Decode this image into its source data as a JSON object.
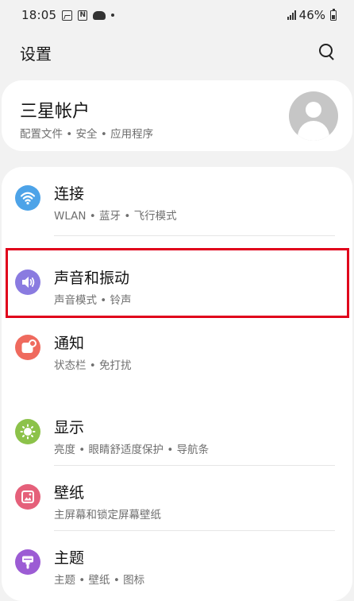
{
  "status_bar": {
    "time": "18:05",
    "battery": "46%"
  },
  "header": {
    "title": "设置"
  },
  "account": {
    "title": "三星帐户",
    "subtitle": "配置文件 • 安全 • 应用程序"
  },
  "settings": [
    {
      "title": "连接",
      "subtitle": "WLAN • 蓝牙 • 飞行模式",
      "icon": "wifi-icon",
      "color": "#4da3e8"
    },
    {
      "title": "声音和振动",
      "subtitle": "声音模式 • 铃声",
      "icon": "volume-icon",
      "color": "#8a7be0"
    },
    {
      "title": "通知",
      "subtitle": "状态栏 • 免打扰",
      "icon": "notification-icon",
      "color": "#ef6a5e"
    },
    {
      "title": "显示",
      "subtitle": "亮度 • 眼睛舒适度保护 • 导航条",
      "icon": "brightness-icon",
      "color": "#8cc24a"
    },
    {
      "title": "壁纸",
      "subtitle": "主屏幕和锁定屏幕壁纸",
      "icon": "wallpaper-icon",
      "color": "#e5607a"
    },
    {
      "title": "主题",
      "subtitle": "主题 • 壁纸 • 图标",
      "icon": "theme-icon",
      "color": "#9c5cd4"
    }
  ],
  "highlight_color": "#e0001b"
}
